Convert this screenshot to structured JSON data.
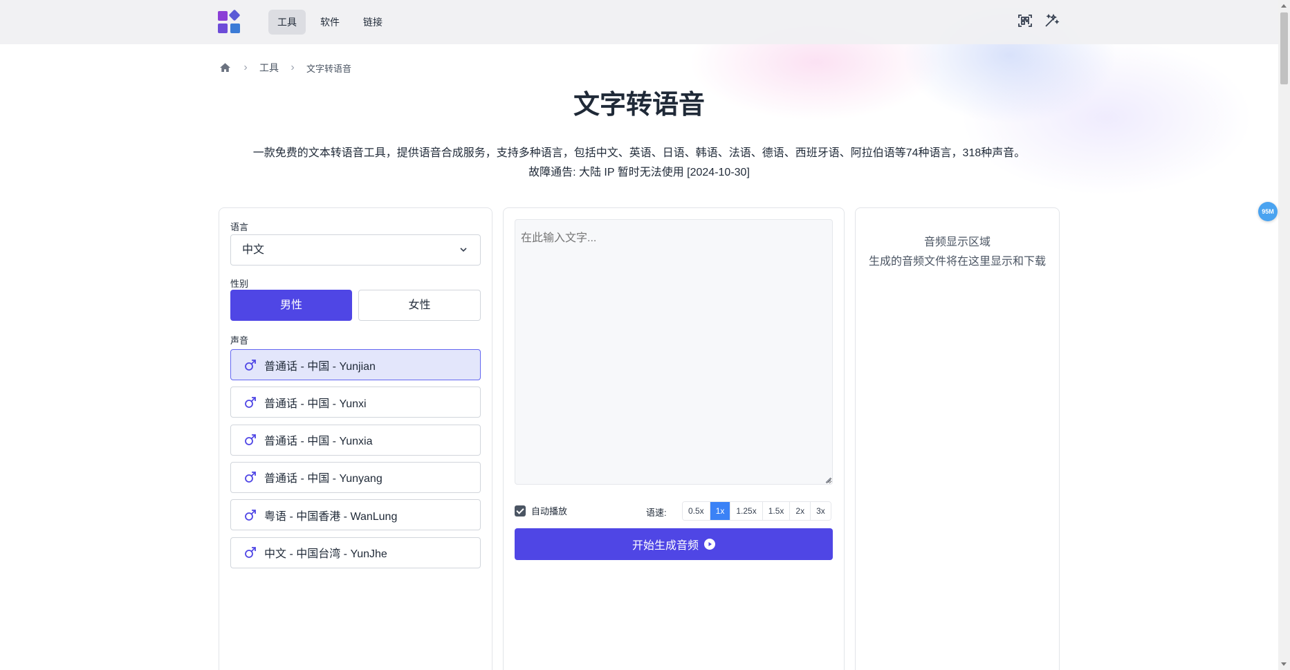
{
  "nav": {
    "items": [
      "工具",
      "软件",
      "链接"
    ],
    "active_index": 0
  },
  "breadcrumb": {
    "items": [
      "工具",
      "文字转语音"
    ]
  },
  "page": {
    "title": "文字转语音",
    "description": "一款免费的文本转语音工具，提供语音合成服务，支持多种语言，包括中文、英语、日语、韩语、法语、德语、西班牙语、阿拉伯语等74种语言，318种声音。",
    "notice": "故障通告: 大陆 IP 暂时无法使用 [2024-10-30]"
  },
  "settings": {
    "language_label": "语言",
    "language_value": "中文",
    "gender_label": "性别",
    "gender_male": "男性",
    "gender_female": "女性",
    "selected_gender": "male",
    "voice_label": "声音",
    "voices": [
      "普通话 - 中国 - Yunjian",
      "普通话 - 中国 - Yunxi",
      "普通话 - 中国 - Yunxia",
      "普通话 - 中国 - Yunyang",
      "粤语 - 中国香港 - WanLung",
      "中文 - 中国台湾 - YunJhe"
    ],
    "selected_voice_index": 0
  },
  "editor": {
    "placeholder": "在此输入文字...",
    "autoplay_label": "自动播放",
    "autoplay_checked": true,
    "speed_label": "语速:",
    "speeds": [
      "0.5x",
      "1x",
      "1.25x",
      "1.5x",
      "2x",
      "3x"
    ],
    "selected_speed": "1x",
    "generate_label": "开始生成音频"
  },
  "audio": {
    "title": "音频显示区域",
    "subtitle": "生成的音频文件将在这里显示和下载"
  },
  "badge": {
    "text": "95M"
  },
  "colors": {
    "accent": "#4f46e5",
    "speed_active": "#3b82f6",
    "selected_voice_bg": "#e3e6fb"
  },
  "icons": [
    "logo-icon",
    "home-icon",
    "scan-icon",
    "magic-wand-icon",
    "chevron-down-icon",
    "male-icon",
    "play-circle-icon"
  ]
}
